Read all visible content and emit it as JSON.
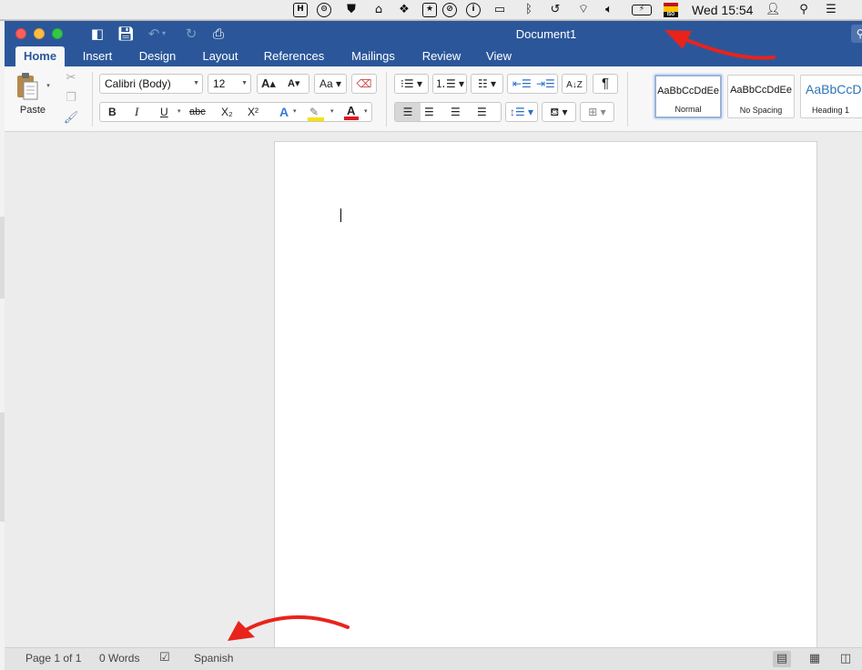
{
  "menubar": {
    "clock": "Wed 15:54",
    "icons": [
      "h-app-icon",
      "sync-icon",
      "shield-icon",
      "bank-icon",
      "dropbox-icon",
      "bookmark-icon",
      "blocked-icon",
      "info-icon",
      "airplay-icon",
      "bluetooth-icon",
      "time-machine-icon",
      "wifi-icon",
      "volume-icon",
      "battery-icon",
      "spanish-flag-icon",
      "user-icon",
      "search-icon",
      "list-icon"
    ]
  },
  "window": {
    "title": "Document1"
  },
  "tabs": [
    "Home",
    "Insert",
    "Design",
    "Layout",
    "References",
    "Mailings",
    "Review",
    "View"
  ],
  "ribbon": {
    "paste_label": "Paste",
    "font_name": "Calibri (Body)",
    "font_size": "12",
    "bold": "B",
    "italic": "I",
    "underline": "U",
    "strike": "abc",
    "sub": "X₂",
    "sup": "X²",
    "styles": [
      {
        "sample": "AaBbCcDdEe",
        "name": "Normal"
      },
      {
        "sample": "AaBbCcDdEe",
        "name": "No Spacing"
      },
      {
        "sample": "AaBbCcDc",
        "name": "Heading 1"
      }
    ],
    "colors": {
      "highlight": "#f5e400",
      "font_color": "#e0161d",
      "accent": "#2b579a"
    }
  },
  "status": {
    "page": "Page 1 of 1",
    "words": "0 Words",
    "language": "Spanish"
  },
  "annotations": {
    "arrow_color": "#e8231c"
  }
}
